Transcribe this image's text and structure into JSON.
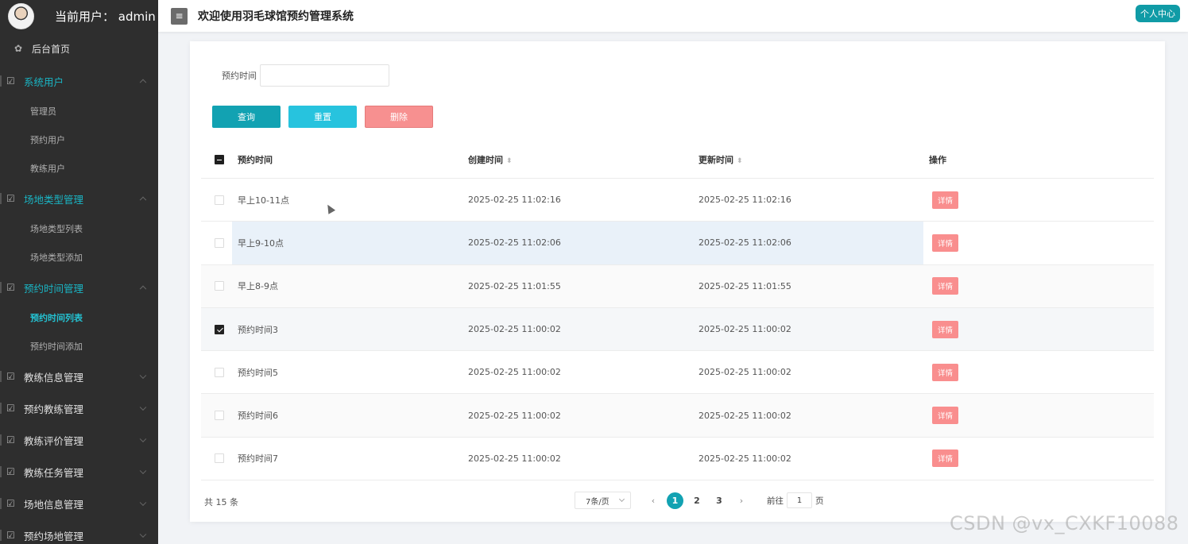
{
  "header": {
    "current_user": "当前用户： admin",
    "site_title": "欢迎使用羽毛球馆预约管理系统",
    "profile_button": "个人中心",
    "menu_icon": "hamburger-icon"
  },
  "sidebar": {
    "home": "后台首页",
    "groups": [
      {
        "label": "系统用户",
        "children": [
          "管理员",
          "预约用户",
          "教练用户"
        ]
      },
      {
        "label": "场地类型管理",
        "children": [
          "场地类型列表",
          "场地类型添加"
        ]
      },
      {
        "label": "预约时间管理",
        "children": [
          "预约时间列表",
          "预约时间添加"
        ]
      },
      {
        "label": "教练信息管理",
        "children": []
      },
      {
        "label": "预约教练管理",
        "children": []
      },
      {
        "label": "教练评价管理",
        "children": []
      },
      {
        "label": "教练任务管理",
        "children": []
      },
      {
        "label": "场地信息管理",
        "children": []
      },
      {
        "label": "预约场地管理",
        "children": []
      }
    ]
  },
  "filter": {
    "label": "预约时间",
    "value": ""
  },
  "actions": {
    "query": "查询",
    "reset": "重置",
    "delete": "删除"
  },
  "table": {
    "columns": [
      "预约时间",
      "创建时间",
      "更新时间",
      "操作"
    ],
    "rows": [
      {
        "name": "早上10-11点",
        "created": "2025-02-25 11:02:16",
        "updated": "2025-02-25 11:02:16",
        "checked": false,
        "op": "详情"
      },
      {
        "name": "早上9-10点",
        "created": "2025-02-25 11:02:06",
        "updated": "2025-02-25 11:02:06",
        "checked": false,
        "op": "详情"
      },
      {
        "name": "早上8-9点",
        "created": "2025-02-25 11:01:55",
        "updated": "2025-02-25 11:01:55",
        "checked": false,
        "op": "详情"
      },
      {
        "name": "预约时间3",
        "created": "2025-02-25 11:00:02",
        "updated": "2025-02-25 11:00:02",
        "checked": true,
        "op": "详情"
      },
      {
        "name": "预约时间5",
        "created": "2025-02-25 11:00:02",
        "updated": "2025-02-25 11:00:02",
        "checked": false,
        "op": "详情"
      },
      {
        "name": "预约时间6",
        "created": "2025-02-25 11:00:02",
        "updated": "2025-02-25 11:00:02",
        "checked": false,
        "op": "详情"
      },
      {
        "name": "预约时间7",
        "created": "2025-02-25 11:00:02",
        "updated": "2025-02-25 11:00:02",
        "checked": false,
        "op": "详情"
      }
    ]
  },
  "pagination": {
    "total": "共 15 条",
    "page_size": "7条/页",
    "pages": [
      "1",
      "2",
      "3"
    ],
    "current_page": "1",
    "goto_prefix": "前往",
    "goto_value": "1",
    "goto_suffix": "页",
    "prev": "‹",
    "next": "›"
  },
  "watermark": "CSDN @vx_CXKF10088"
}
